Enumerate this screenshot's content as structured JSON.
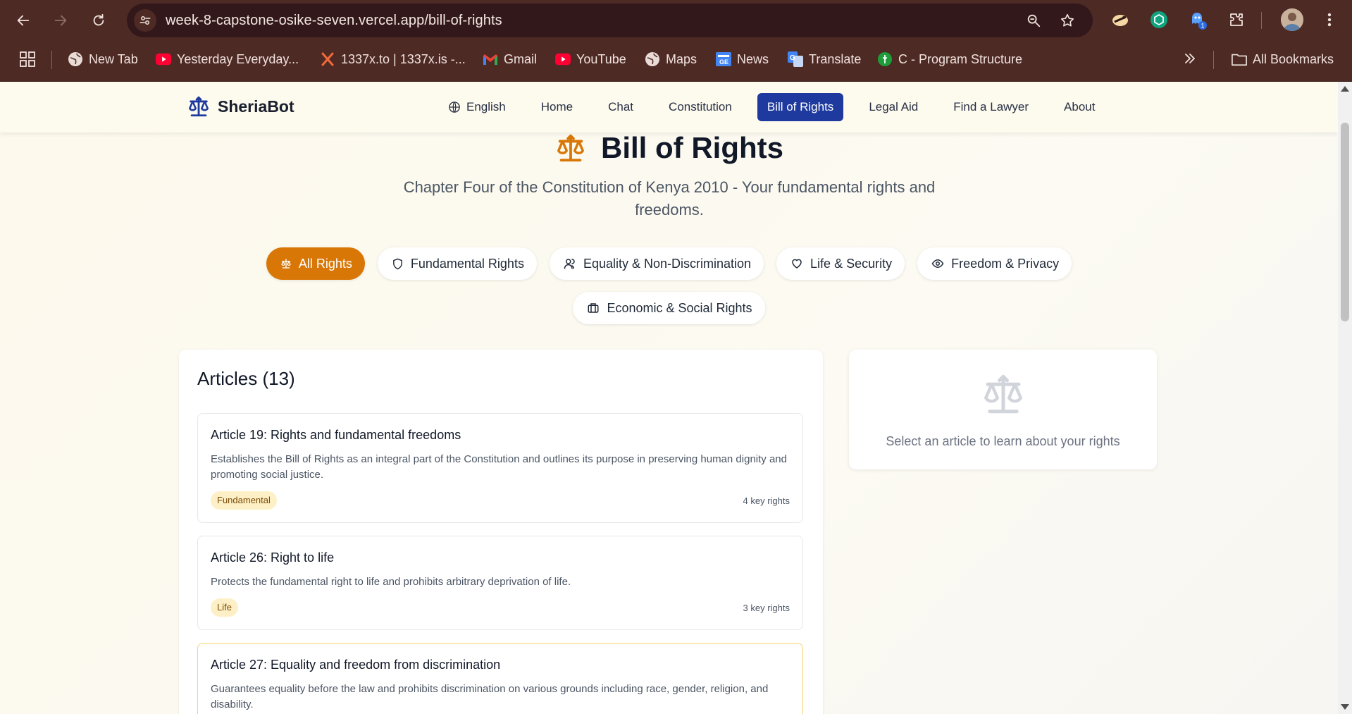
{
  "browser": {
    "url": "week-8-capstone-osike-seven.vercel.app/bill-of-rights",
    "extension_badge": "1",
    "bookmarks": [
      {
        "label": "New Tab",
        "icon": "globe-icon"
      },
      {
        "label": "Yesterday Everyday...",
        "icon": "youtube-icon"
      },
      {
        "label": "1337x.to | 1337x.is -...",
        "icon": "x-logo-icon"
      },
      {
        "label": "Gmail",
        "icon": "gmail-icon"
      },
      {
        "label": "YouTube",
        "icon": "youtube-icon"
      },
      {
        "label": "Maps",
        "icon": "globe-icon"
      },
      {
        "label": "News",
        "icon": "news-icon"
      },
      {
        "label": "Translate",
        "icon": "translate-icon"
      },
      {
        "label": "C - Program Structure",
        "icon": "leaf-icon"
      }
    ],
    "all_bookmarks": "All Bookmarks"
  },
  "header": {
    "brand": "SheriaBot",
    "language": "English",
    "nav": [
      "Home",
      "Chat",
      "Constitution",
      "Bill of Rights",
      "Legal Aid",
      "Find a Lawyer",
      "About"
    ],
    "active_nav": "Bill of Rights"
  },
  "hero": {
    "title": "Bill of Rights",
    "subtitle": "Chapter Four of the Constitution of Kenya 2010 - Your fundamental rights and freedoms."
  },
  "filters": [
    {
      "label": "All Rights",
      "icon": "scales-icon",
      "active": true
    },
    {
      "label": "Fundamental Rights",
      "icon": "shield-icon",
      "active": false
    },
    {
      "label": "Equality & Non-Discrimination",
      "icon": "users-icon",
      "active": false
    },
    {
      "label": "Life & Security",
      "icon": "heart-icon",
      "active": false
    },
    {
      "label": "Freedom & Privacy",
      "icon": "eye-icon",
      "active": false
    },
    {
      "label": "Economic & Social Rights",
      "icon": "briefcase-icon",
      "active": false
    }
  ],
  "articles": {
    "heading": "Articles (13)",
    "items": [
      {
        "title": "Article 19: Rights and fundamental freedoms",
        "description": "Establishes the Bill of Rights as an integral part of the Constitution and outlines its purpose in preserving human dignity and promoting social justice.",
        "tag": "Fundamental",
        "key_rights": "4 key rights"
      },
      {
        "title": "Article 26: Right to life",
        "description": "Protects the fundamental right to life and prohibits arbitrary deprivation of life.",
        "tag": "Life",
        "key_rights": "3 key rights"
      },
      {
        "title": "Article 27: Equality and freedom from discrimination",
        "description": "Guarantees equality before the law and prohibits discrimination on various grounds including race, gender, religion, and disability."
      }
    ]
  },
  "detail": {
    "placeholder": "Select an article to learn about your rights"
  },
  "colors": {
    "accent": "#d97706",
    "nav_active": "#1e3a9e",
    "brand_icon": "#1e3a9e",
    "chrome": "#4e2a25",
    "tag_bg": "#fdf0c6"
  }
}
